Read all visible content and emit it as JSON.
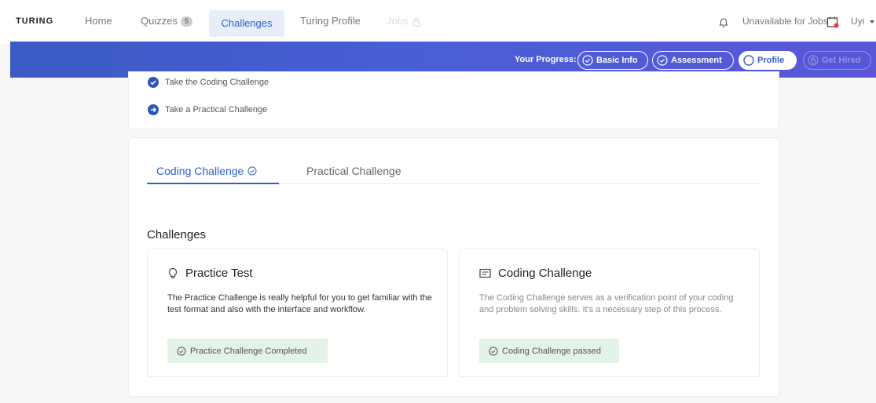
{
  "nav": {
    "logo": "TURING",
    "home": "Home",
    "quizzes": "Quizzes",
    "quizzes_count": "5",
    "challenges": "Challenges",
    "turing_profile": "Turing Profile",
    "jobs": "Jobs",
    "availability": "Unavailable for Jobs",
    "user": "Uyi"
  },
  "progress": {
    "label": "Your Progress:",
    "steps": [
      "Basic Info",
      "Assessment",
      "Profile",
      "Get Hired"
    ]
  },
  "steps_card": {
    "items": [
      "Take the Coding Challenge",
      "Take a Practical Challenge"
    ]
  },
  "tabs": {
    "coding": "Coding Challenge",
    "practical": "Practical Challenge"
  },
  "challenges": {
    "heading": "Challenges",
    "practice": {
      "title": "Practice Test",
      "description": "The Practice Challenge is really helpful for you to get familiar with the test format and also with the interface and workflow.",
      "status": "Practice Challenge Completed"
    },
    "coding": {
      "title": "Coding Challenge",
      "description": "The Coding Challenge serves as a verification point of your coding and problem solving skills. It's a necessary step of this process.",
      "status": "Coding Challenge passed"
    }
  },
  "colors": {
    "accent": "#2d63c8",
    "banner": "#4a5ed6",
    "success_bg": "#e3f3e8"
  }
}
